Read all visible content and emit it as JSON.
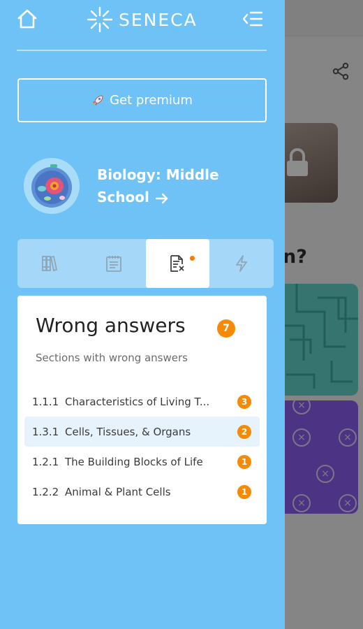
{
  "app": {
    "name": "SENECA",
    "accent_color": "#6ec2f5",
    "badge_color": "#f58a07"
  },
  "topbar": {
    "home_icon": "home-icon",
    "collapse_icon": "collapse-menu-icon"
  },
  "premium": {
    "icon": "rocket-icon",
    "label": "Get premium"
  },
  "course": {
    "title": "Biology: Middle School"
  },
  "tabs": [
    {
      "icon": "books-icon",
      "active": false
    },
    {
      "icon": "notepad-icon",
      "active": false
    },
    {
      "icon": "wrong-answers-doc-icon",
      "active": true,
      "has_notification_dot": true
    },
    {
      "icon": "lightning-icon",
      "active": false
    }
  ],
  "wrong_answers": {
    "title": "Wrong answers",
    "count": "7",
    "subtitle": "Sections with wrong answers",
    "sections": [
      {
        "number": "1.1.1",
        "title": "Characteristics of Living T...",
        "count": "3",
        "highlighted": false
      },
      {
        "number": "1.3.1",
        "title": "Cells, Tissues, & Organs",
        "count": "2",
        "highlighted": true
      },
      {
        "number": "1.2.1",
        "title": "The Building Blocks of Life",
        "count": "1",
        "highlighted": false
      },
      {
        "number": "1.2.2",
        "title": "Animal & Plant Cells",
        "count": "1",
        "highlighted": false
      }
    ]
  },
  "background": {
    "question_fragment": "n?"
  }
}
